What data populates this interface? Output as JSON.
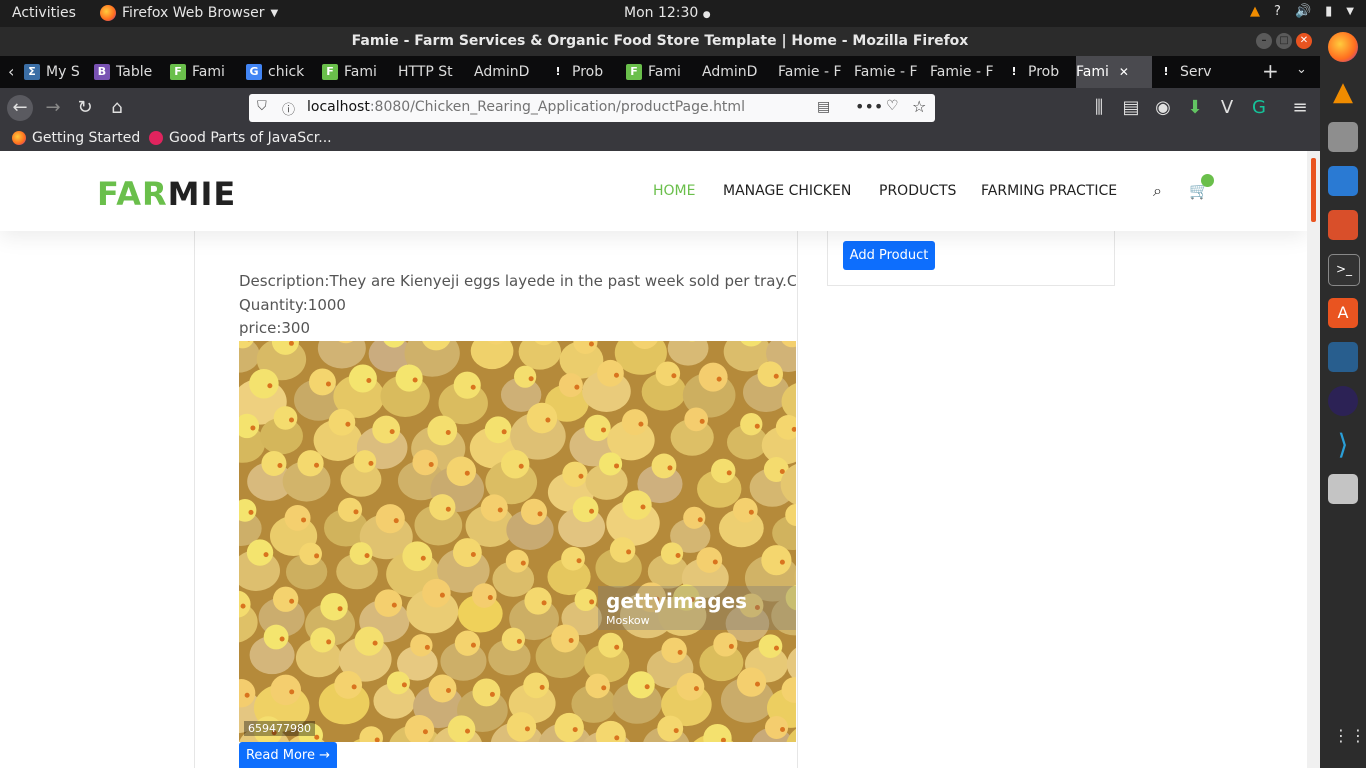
{
  "os": {
    "activities": "Activities",
    "app_menu": "Firefox Web Browser",
    "clock": "Mon 12:30"
  },
  "window": {
    "title": "Famie - Farm Services & Organic Food Store Template | Home - Mozilla Firefox"
  },
  "tabs": [
    {
      "label": "My S",
      "fav": "Σ",
      "color": "#3b6ea5"
    },
    {
      "label": "Table",
      "fav": "B",
      "color": "#7952b3"
    },
    {
      "label": "Fami",
      "fav": "F",
      "color": "#6abf4b"
    },
    {
      "label": "chick",
      "fav": "G",
      "color": "#4285f4"
    },
    {
      "label": "Fami",
      "fav": "F",
      "color": "#6abf4b"
    },
    {
      "label": "HTTP St",
      "fav": "",
      "color": "#0c0c0d"
    },
    {
      "label": "AdminD",
      "fav": "",
      "color": "#0c0c0d"
    },
    {
      "label": "Prob",
      "fav": "!",
      "color": "#0c0c0d"
    },
    {
      "label": "Fami",
      "fav": "F",
      "color": "#6abf4b"
    },
    {
      "label": "AdminD",
      "fav": "",
      "color": "#0c0c0d"
    },
    {
      "label": "Famie - F",
      "fav": "",
      "color": "#0c0c0d"
    },
    {
      "label": "Famie - F",
      "fav": "",
      "color": "#0c0c0d"
    },
    {
      "label": "Famie - F",
      "fav": "",
      "color": "#0c0c0d"
    },
    {
      "label": "Prob",
      "fav": "!",
      "color": "#0c0c0d"
    },
    {
      "label": "Fami",
      "fav": "",
      "color": "#4a4a4f"
    },
    {
      "label": "Serv",
      "fav": "!",
      "color": "#0c0c0d"
    }
  ],
  "url": {
    "host": "localhost",
    "rest": ":8080/Chicken_Rearing_Application/productPage.html"
  },
  "bookmarks": [
    {
      "label": "Getting Started"
    },
    {
      "label": "Good Parts of JavaScr..."
    }
  ],
  "site": {
    "logo_a": "FAR",
    "logo_b": "MIE",
    "menu": [
      "HOME",
      "MANAGE CHICKEN",
      "PRODUCTS",
      "FARMING PRACTICE"
    ],
    "accent": "#6abf4b"
  },
  "product": {
    "description": "Description:They are Kienyeji eggs layede in the past week sold per tray.Contac",
    "quantity": "Quantity:1000",
    "price": "price:300",
    "add_button": "Add Product",
    "read_more": "Read More →",
    "watermark": "gettyimages",
    "watermark_user": "Moskow",
    "photo_id": "659477980"
  }
}
